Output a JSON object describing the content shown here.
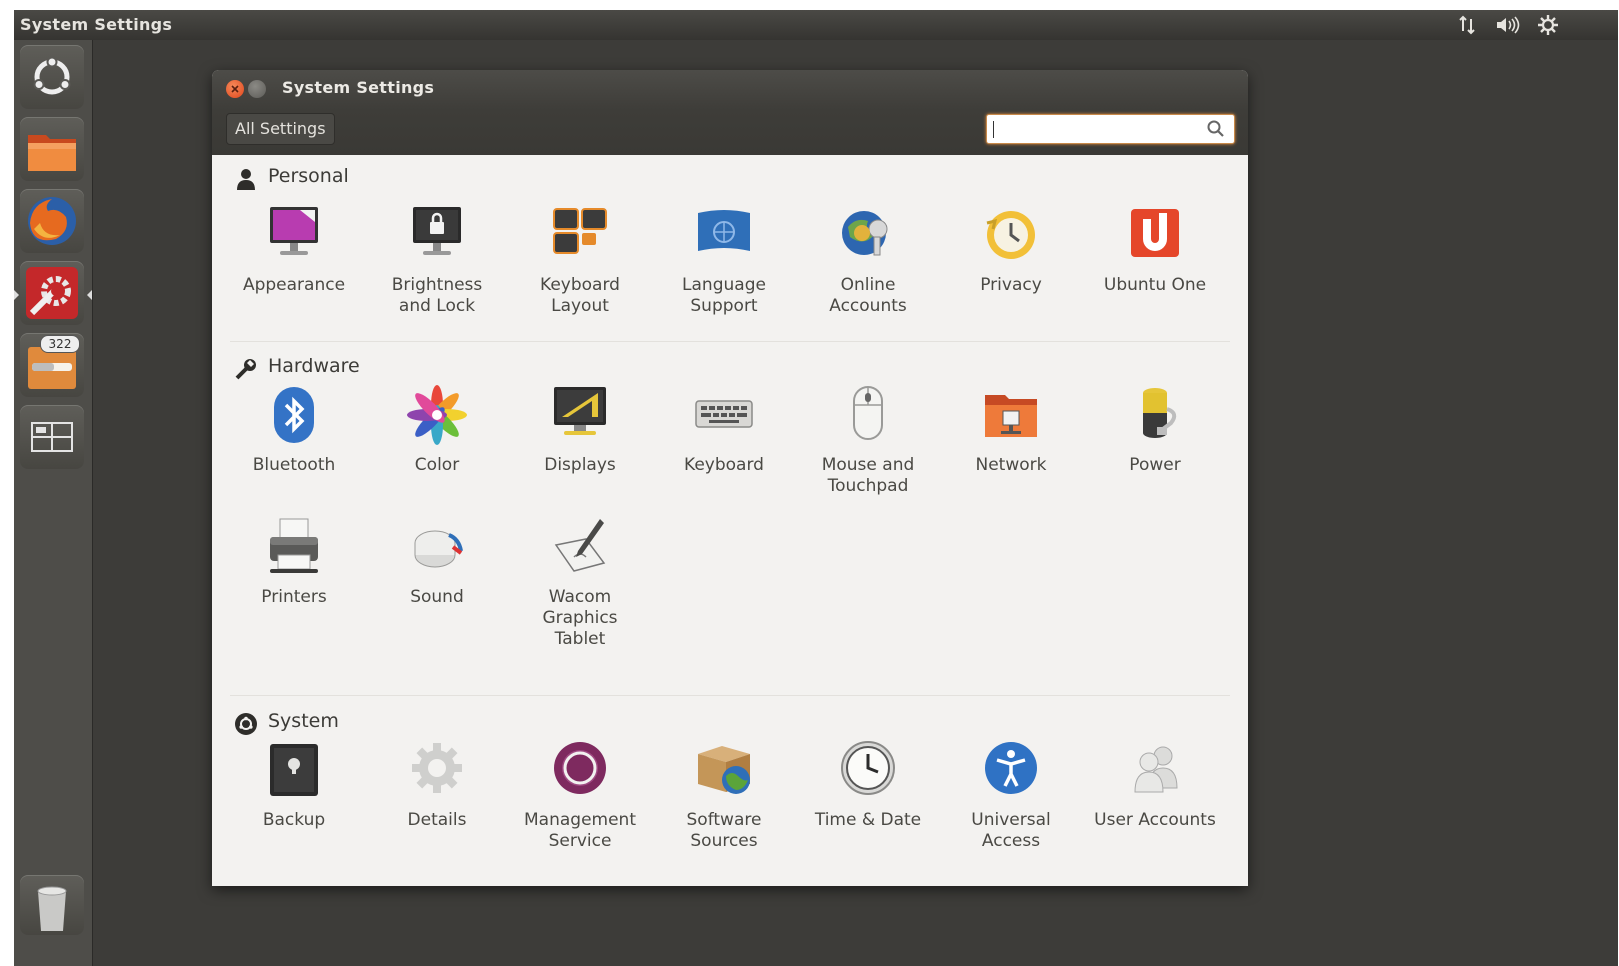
{
  "topbar": {
    "title": "System Settings"
  },
  "launcher": {
    "badge_count": "322"
  },
  "window": {
    "title": "System Settings",
    "all_settings": "All Settings",
    "search_placeholder": ""
  },
  "sections": {
    "personal": {
      "heading": "Personal",
      "items": [
        "Appearance",
        "Brightness\nand Lock",
        "Keyboard\nLayout",
        "Language\nSupport",
        "Online\nAccounts",
        "Privacy",
        "Ubuntu One"
      ]
    },
    "hardware": {
      "heading": "Hardware",
      "items": [
        "Bluetooth",
        "Color",
        "Displays",
        "Keyboard",
        "Mouse and\nTouchpad",
        "Network",
        "Power",
        "Printers",
        "Sound",
        "Wacom\nGraphics\nTablet"
      ]
    },
    "system": {
      "heading": "System",
      "items": [
        "Backup",
        "Details",
        "Management\nService",
        "Software\nSources",
        "Time & Date",
        "Universal\nAccess",
        "User Accounts"
      ]
    }
  },
  "colors": {
    "accent": "#dd4814",
    "panel": "#3d3c39",
    "window_bg": "#f3f2f0"
  }
}
